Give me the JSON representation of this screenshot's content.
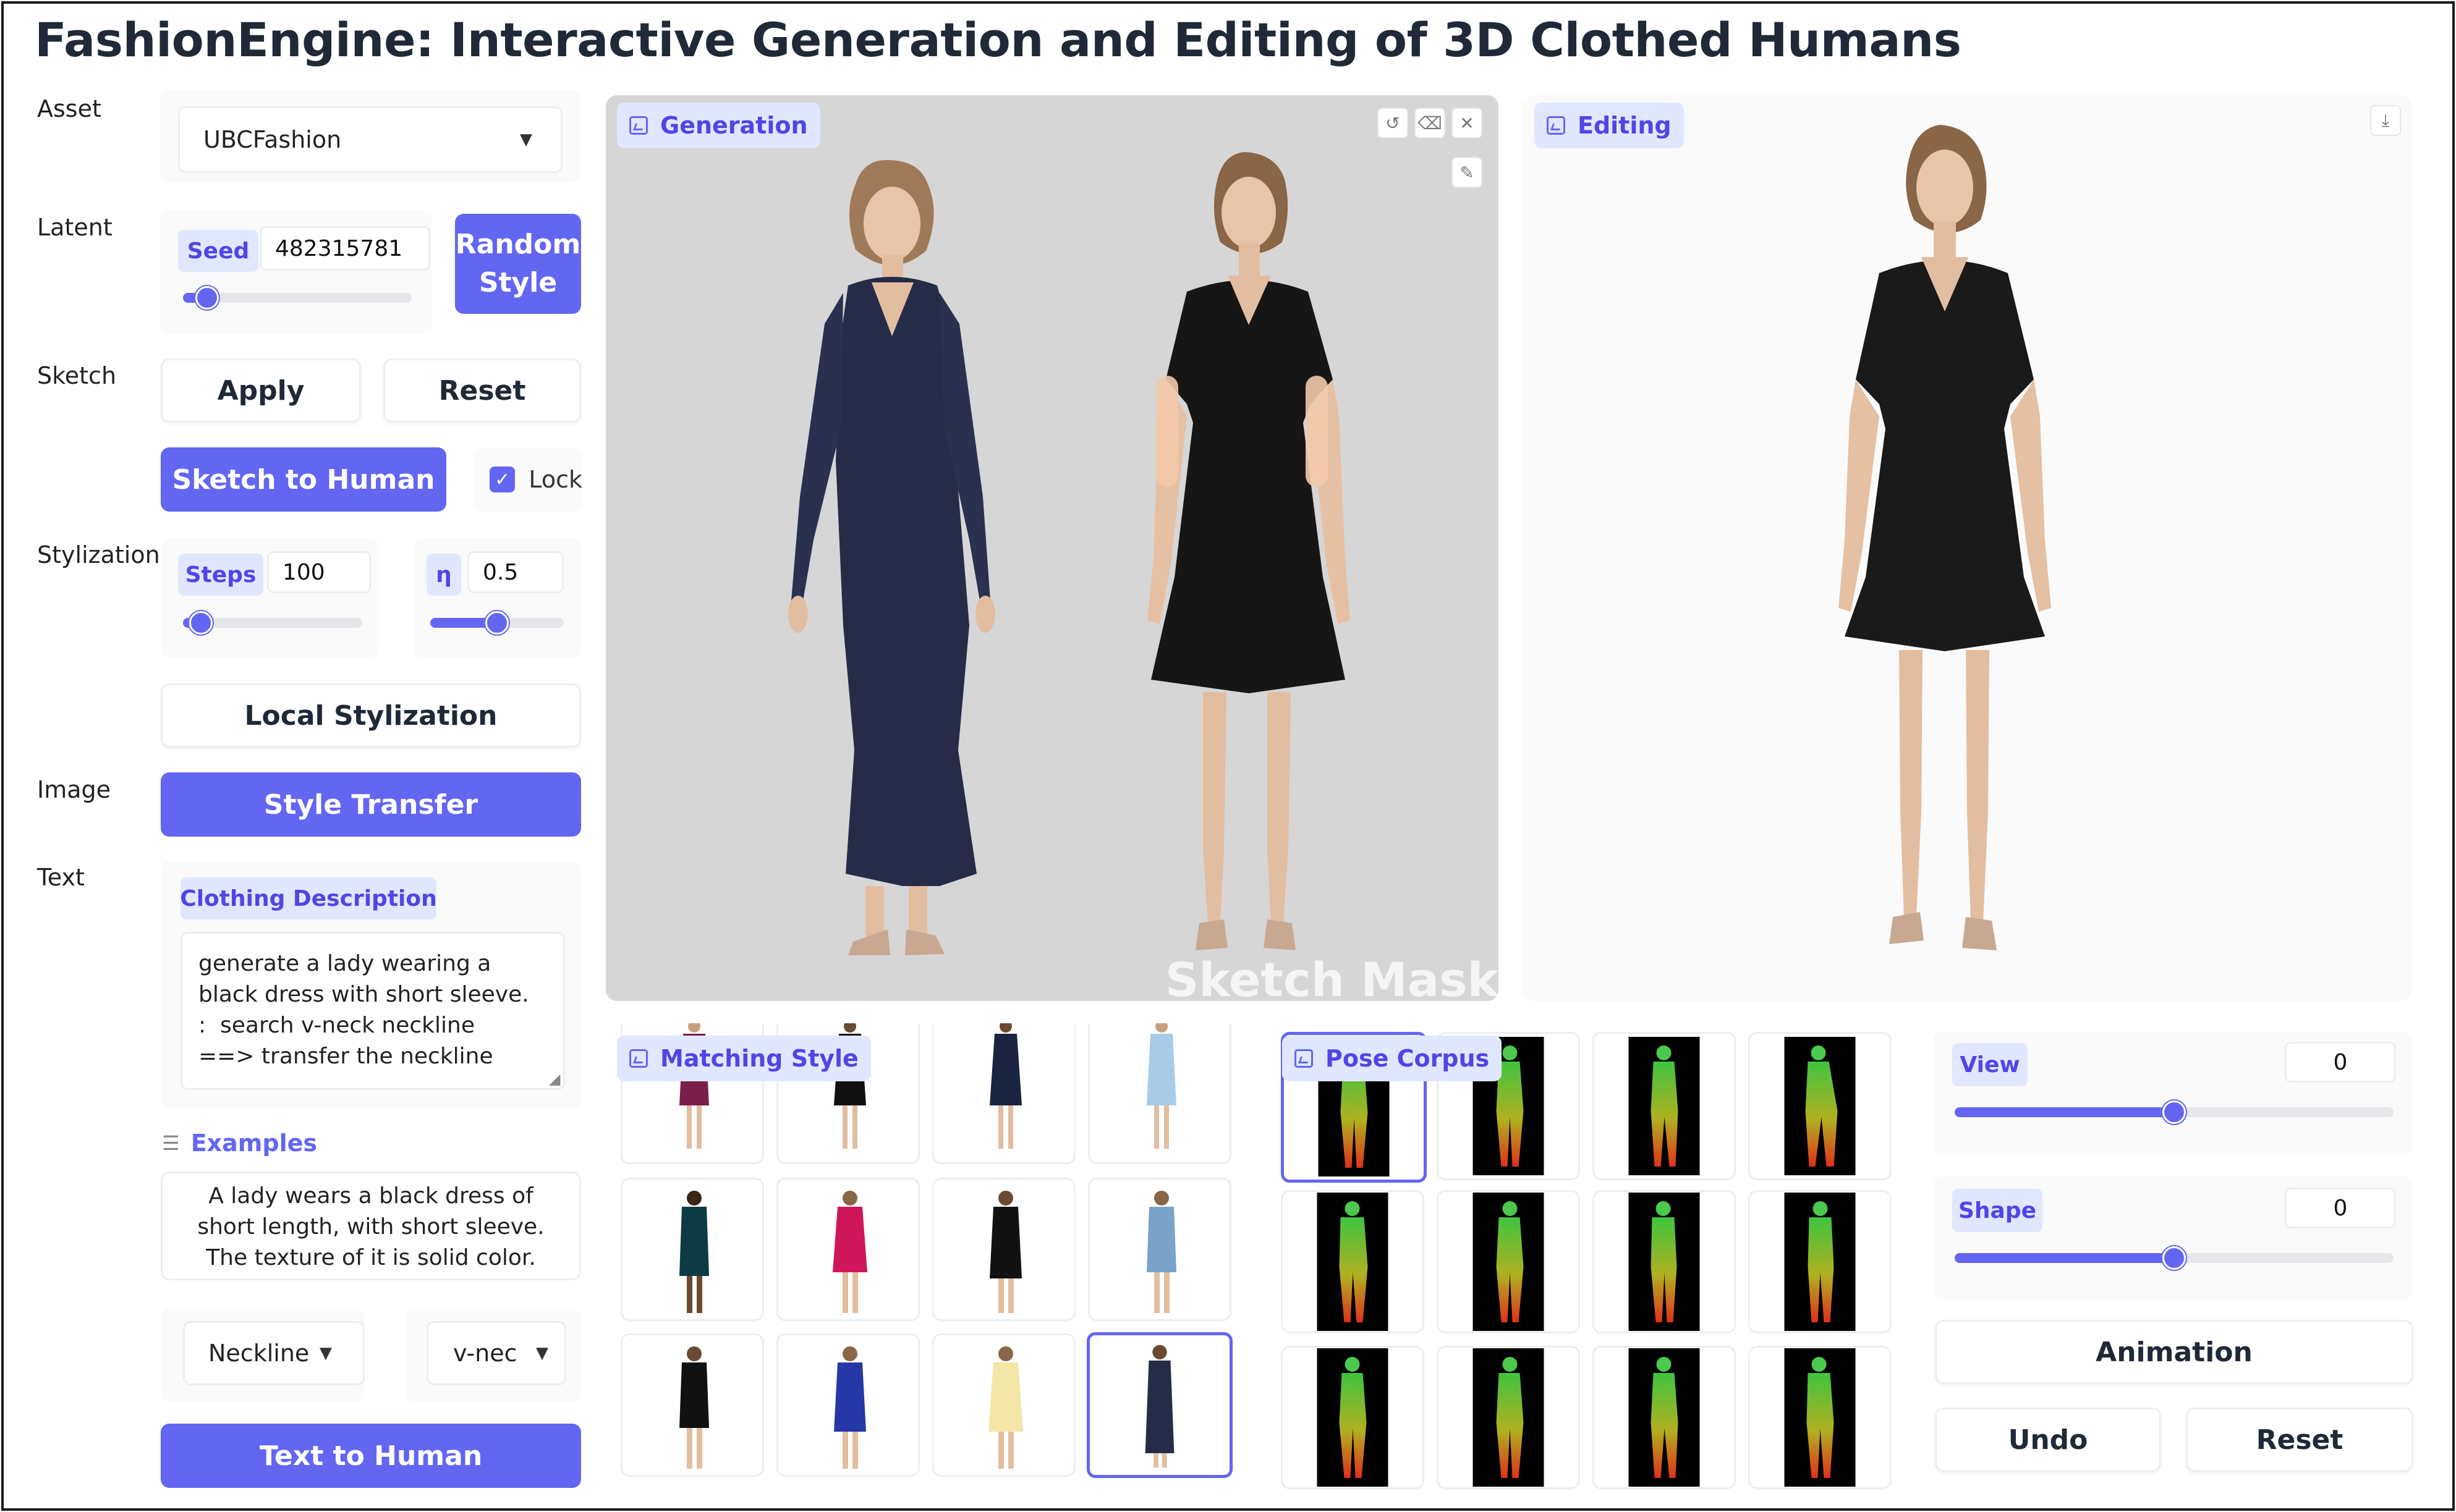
{
  "app": {
    "title": "FashionEngine: Interactive Generation and Editing of 3D Clothed Humans"
  },
  "labels": {
    "asset": "Asset",
    "latent": "Latent",
    "sketch": "Sketch",
    "stylization": "Stylization",
    "image": "Image",
    "text": "Text"
  },
  "asset": {
    "selected": "UBCFashion"
  },
  "latent": {
    "seed_label": "Seed",
    "seed_value": "482315781",
    "random_style_line1": "Random",
    "random_style_line2": "Style"
  },
  "sketch": {
    "apply": "Apply",
    "reset": "Reset",
    "to_human": "Sketch to Human",
    "lock_label": "Lock",
    "lock_checked": true
  },
  "stylization": {
    "steps_label": "Steps",
    "steps_value": "100",
    "eta_label": "η",
    "eta_value": "0.5",
    "local": "Local Stylization"
  },
  "image": {
    "style_transfer": "Style Transfer"
  },
  "text": {
    "clothing_label": "Clothing Description",
    "clothing_value": "generate a lady wearing a black dress with short sleeve.\n:  search v-neck neckline\n==> transfer the neckline",
    "examples_label": "Examples",
    "example_text": "A lady wears a black dress of short length, with short sleeve. The texture of it is solid color.",
    "attribute": "Neckline",
    "attribute_value": "v-nec",
    "to_human": "Text to Human"
  },
  "generation": {
    "label": "Generation",
    "overlay_text": "Sketch Mask"
  },
  "editing": {
    "label": "Editing"
  },
  "matching": {
    "label": "Matching Style"
  },
  "pose": {
    "label": "Pose Corpus"
  },
  "controls": {
    "view_label": "View",
    "view_value": "0",
    "shape_label": "Shape",
    "shape_value": "0",
    "animation": "Animation",
    "undo": "Undo",
    "reset": "Reset"
  },
  "colors": {
    "accent": "#6366f1",
    "accent_light": "#e0e7ff"
  }
}
